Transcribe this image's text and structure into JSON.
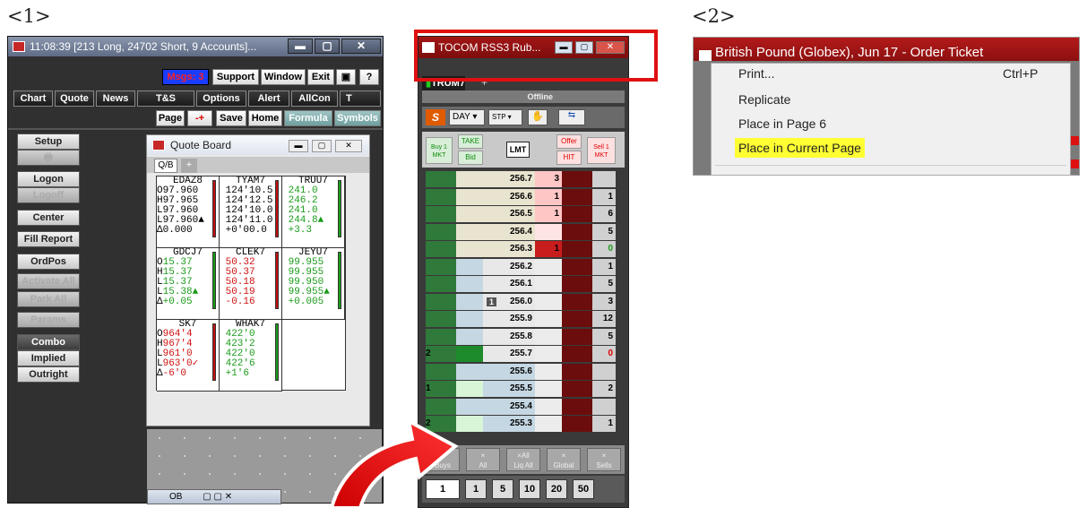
{
  "panel_labels": [
    "<1>",
    "<2>"
  ],
  "main_window": {
    "title": "11:08:39  [213 Long, 24702 Short, 9 Accounts]...",
    "toolbar1": [
      "Msgs: 3",
      "Support",
      "Window",
      "Exit"
    ],
    "toolbar2": [
      "Chart",
      "Quote",
      "News",
      "T&S",
      "Options",
      "Alert",
      "AllCon",
      "T"
    ],
    "toolbar3": [
      "Page",
      "-+",
      "Save",
      "Home",
      "Formula",
      "Symbols"
    ],
    "side_buttons": [
      "Setup",
      "Logon",
      "Logoff",
      "Center",
      "Fill Report",
      "OrdPos",
      "Activate All",
      "Park All",
      "Params",
      "Combo",
      "Implied",
      "Outright"
    ]
  },
  "quote_board": {
    "title": "Quote Board",
    "tab": "Q/B",
    "bottom_title": "OB",
    "row_labels": [
      "O",
      "H",
      "L",
      "L",
      "Δ"
    ],
    "cells": [
      {
        "symbol": "EDAZ8",
        "lines": [
          "97.960",
          "97.965",
          "97.960",
          "97.960▲",
          "0.000"
        ],
        "color": "k"
      },
      {
        "symbol": "TYAM7",
        "lines": [
          "124'10.5",
          "124'12.5",
          "124'10.0",
          "124'11.0",
          "+0'00.0"
        ],
        "color": "k"
      },
      {
        "symbol": "TRUU7",
        "lines": [
          "241.0",
          "246.2",
          "241.0",
          "244.8▲",
          "+3.3"
        ],
        "color": "g"
      },
      {
        "symbol": "GDCJ7",
        "lines": [
          "15.37",
          "15.37",
          "15.37",
          "15.38▲",
          "+0.05"
        ],
        "color": "g"
      },
      {
        "symbol": "CLEK7",
        "lines": [
          "50.32",
          "50.37",
          "50.18",
          "50.19",
          "-0.16"
        ],
        "color": "r"
      },
      {
        "symbol": "JEYU7",
        "lines": [
          "99.955",
          "99.955",
          "99.950",
          "99.955▲",
          "+0.005"
        ],
        "color": "g"
      },
      {
        "symbol": "SK7",
        "lines": [
          "964'4",
          "967'4",
          "961'0",
          "963'0✓",
          "-6'0"
        ],
        "color": "r"
      },
      {
        "symbol": "WHAK7",
        "lines": [
          "422'0",
          "423'2",
          "422'0",
          "422'6",
          "+1'6"
        ],
        "color": "g"
      }
    ]
  },
  "ladder": {
    "title": "TOCOM RSS3 Rub...",
    "tab": "TRUM7",
    "status": "Offline",
    "tif": "DAY",
    "stp": "STP",
    "buy_label": "Buy 1 MKT",
    "take": "TAKE",
    "bid": "Bid",
    "lmt": "LMT",
    "offer": "Offer",
    "hit": "HIT",
    "sell_label": "Sell 1 MKT",
    "rows": [
      {
        "price": "256.7",
        "ask": "3",
        "right": ""
      },
      {
        "price": "256.6",
        "ask": "1",
        "right": "1"
      },
      {
        "price": "256.5",
        "ask": "1",
        "right": "6"
      },
      {
        "price": "256.4",
        "ask": "",
        "right": "5"
      },
      {
        "price": "256.3",
        "ask": "1",
        "right": "0"
      },
      {
        "price": "256.2",
        "ask": "",
        "right": "1"
      },
      {
        "price": "256.1",
        "ask": "",
        "right": "5"
      },
      {
        "price": "256.0",
        "ask": "",
        "right": "3",
        "marker": "1"
      },
      {
        "price": "255.9",
        "ask": "",
        "right": "12"
      },
      {
        "price": "255.8",
        "ask": "",
        "right": "5"
      },
      {
        "price": "255.7",
        "ask": "",
        "right": "0",
        "bid": "2"
      },
      {
        "price": "255.6",
        "ask": "",
        "right": ""
      },
      {
        "price": "255.5",
        "ask": "",
        "right": "2",
        "bid": "1"
      },
      {
        "price": "255.4",
        "ask": "",
        "right": ""
      },
      {
        "price": "255.3",
        "ask": "",
        "right": "1",
        "bid": "2"
      }
    ],
    "cancel_buttons": [
      "Buys",
      "All",
      "Liq All",
      "Global",
      "Sells"
    ],
    "cancel_top": [
      "×",
      "×",
      "×All",
      "×",
      "×"
    ],
    "qty_buttons": [
      "1",
      "1",
      "5",
      "10",
      "20",
      "50"
    ]
  },
  "panel2": {
    "title": "British Pound (Globex), Jun 17 - Order Ticket",
    "menu": [
      {
        "label": "Print...",
        "shortcut": "Ctrl+P"
      },
      {
        "label": "Replicate",
        "shortcut": ""
      },
      {
        "label": "Place in Page 6",
        "shortcut": ""
      },
      {
        "label": "Place in Current Page",
        "shortcut": ""
      }
    ]
  }
}
